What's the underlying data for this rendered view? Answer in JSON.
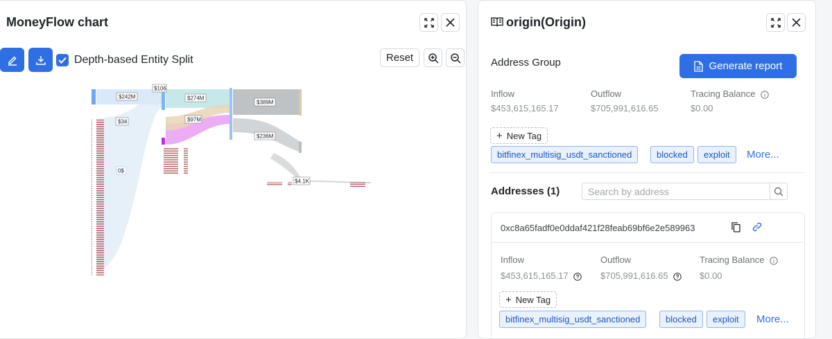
{
  "left_panel": {
    "title": "MoneyFlow chart",
    "checkbox_label": "Depth-based Entity Split",
    "checkbox_checked": true,
    "reset_label": "Reset",
    "chart_labels": {
      "a": "$242M",
      "b": "$106",
      "c": "$274M",
      "d": "$389M",
      "e": "$97M",
      "f": "$236M",
      "g": "$34",
      "h": "0$",
      "i": "$4.1K"
    }
  },
  "right_panel": {
    "title": "origin(Origin)",
    "section_title": "Address Group",
    "generate_report_label": "Generate report",
    "stats": {
      "inflow_label": "Inflow",
      "inflow_value": "$453,615,165.17",
      "outflow_label": "Outflow",
      "outflow_value": "$705,991,616.65",
      "balance_label": "Tracing Balance",
      "balance_value": "$0.00"
    },
    "new_tag_label": "New Tag",
    "tags": [
      "bitfinex_multisig_usdt_sanctioned",
      "blocked",
      "exploit"
    ],
    "more_label": "More...",
    "addresses_label": "Addresses (1)",
    "search_placeholder": "Search by address",
    "address_card": {
      "address": "0xc8a65fadf0e0ddaf421f28feab69bf6e2e589963",
      "inflow_label": "Inflow",
      "inflow_value": "$453,615,165.17",
      "outflow_label": "Outflow",
      "outflow_value": "$705,991,616.65",
      "balance_label": "Tracing Balance",
      "balance_value": "$0.00",
      "new_tag_label": "New Tag",
      "tags": [
        "bitfinex_multisig_usdt_sanctioned",
        "blocked",
        "exploit"
      ],
      "more_label": "More..."
    }
  },
  "colors": {
    "accent": "#2f6fe4",
    "tag_bg": "#e9f1fd",
    "tag_border": "#8fb4ee"
  }
}
